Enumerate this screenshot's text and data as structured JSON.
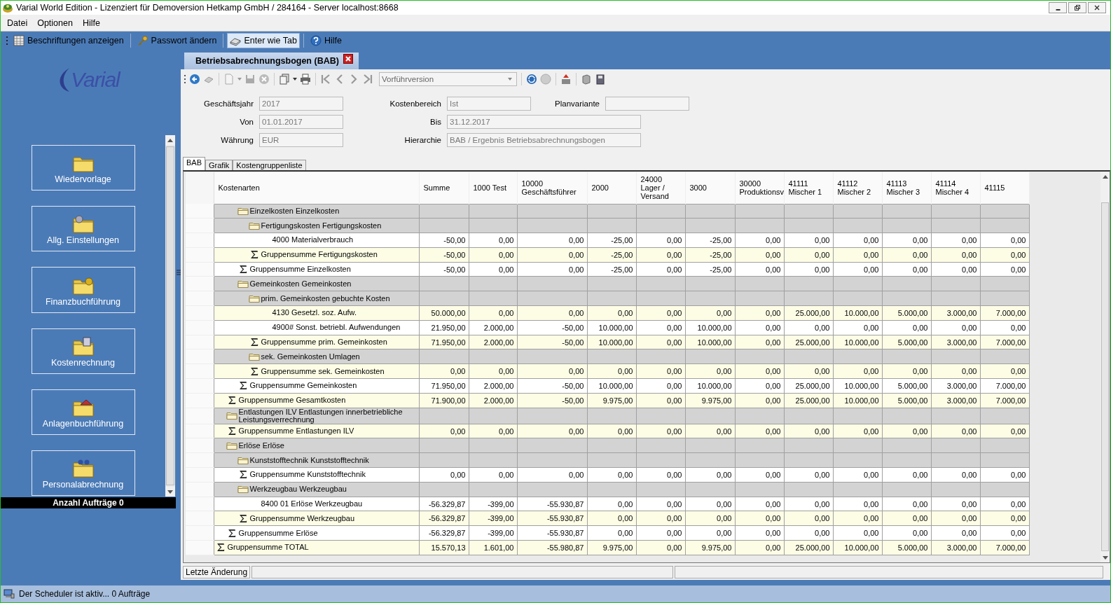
{
  "window": {
    "title": "Varial World Edition - Lizenziert für Demoversion Hetkamp GmbH / 284164 - Server localhost:8668"
  },
  "menu": [
    "Datei",
    "Optionen",
    "Hilfe"
  ],
  "toolbar": [
    {
      "label": "Beschriftungen anzeigen",
      "selected": false
    },
    {
      "label": "Passwort ändern",
      "selected": false
    },
    {
      "label": "Enter wie Tab",
      "selected": true
    },
    {
      "label": "Hilfe",
      "selected": false
    }
  ],
  "sidebar": {
    "logo": "Varial",
    "items": [
      {
        "label": "Wiedervorlage"
      },
      {
        "label": "Allg. Einstellungen"
      },
      {
        "label": "Finanzbuchführung"
      },
      {
        "label": "Kostenrechnung"
      },
      {
        "label": "Anlagenbuchführung"
      },
      {
        "label": "Personalabrechnung"
      }
    ],
    "orders": "Anzahl Aufträge 0"
  },
  "document": {
    "tab": "Betriebsabrechnungsbogen (BAB)",
    "version_select": "Vorführversion",
    "form": [
      [
        {
          "label": "Geschäftsjahr",
          "value": "2017"
        },
        {
          "label": "Kostenbereich",
          "value": "Ist"
        },
        {
          "label": "Planvariante"
        }
      ],
      [
        {
          "label": "Von",
          "value": "01.01.2017"
        },
        {
          "label": "Bis",
          "value": "31.12.2017"
        }
      ],
      [
        {
          "label": "Währung",
          "value": "EUR"
        },
        {
          "label": "Hierarchie",
          "value": "BAB / Ergebnis Betriebsabrechnungsbogen"
        }
      ]
    ],
    "tabs": [
      {
        "label": "BAB",
        "selected": true
      },
      {
        "label": "Grafik",
        "selected": false
      },
      {
        "label": "Kostengruppenliste",
        "selected": false
      }
    ],
    "table": {
      "columns": [
        "Kostenarten",
        "Summe",
        "1000 Test",
        "10000\nGeschäftsführer",
        "2000",
        "24000\nLager /\nVersand",
        "3000",
        "30000\nProduktionsv",
        "41111\nMischer 1",
        "41112\nMischer 2",
        "41113\nMischer 3",
        "41114\nMischer 4",
        "41115"
      ],
      "rows": [
        {
          "kind": "branch",
          "children": [
            {
              "kind": "branch",
              "children": [
                {
                  "kind": "group",
                  "label": "Einzelkosten Einzelkosten",
                  "children": [
                    {
                      "kind": "group",
                      "label": "Fertigungskosten Fertigungskosten",
                      "children": [
                        {
                          "kind": "item",
                          "label": "4000 Materialverbrauch",
                          "values": [
                            "-50,00",
                            "0,00",
                            "0,00",
                            "-25,00",
                            "0,00",
                            "-25,00",
                            "0,00",
                            "0,00",
                            "0,00",
                            "0,00",
                            "0,00",
                            "0,00"
                          ]
                        }
                      ]
                    },
                    {
                      "kind": "sum",
                      "label": "Gruppensumme Fertigungskosten",
                      "values": [
                        "-50,00",
                        "0,00",
                        "0,00",
                        "-25,00",
                        "0,00",
                        "-25,00",
                        "0,00",
                        "0,00",
                        "0,00",
                        "0,00",
                        "0,00",
                        "0,00"
                      ]
                    }
                  ]
                },
                {
                  "kind": "sum",
                  "label": "Gruppensumme Einzelkosten",
                  "values": [
                    "-50,00",
                    "0,00",
                    "0,00",
                    "-25,00",
                    "0,00",
                    "-25,00",
                    "0,00",
                    "0,00",
                    "0,00",
                    "0,00",
                    "0,00",
                    "0,00"
                  ]
                },
                {
                  "kind": "group",
                  "label": "Gemeinkosten Gemeinkosten",
                  "children": [
                    {
                      "kind": "group",
                      "label": "prim. Gemeinkosten gebuchte Kosten",
                      "children": [
                        {
                          "kind": "item",
                          "label": "4130 Gesetzl. soz. Aufw.",
                          "values": [
                            "50.000,00",
                            "0,00",
                            "0,00",
                            "0,00",
                            "0,00",
                            "0,00",
                            "0,00",
                            "25.000,00",
                            "10.000,00",
                            "5.000,00",
                            "3.000,00",
                            "7.000,00"
                          ]
                        },
                        {
                          "kind": "item",
                          "label": "4900# Sonst. betriebl. Aufwendungen",
                          "values": [
                            "21.950,00",
                            "2.000,00",
                            "-50,00",
                            "10.000,00",
                            "0,00",
                            "10.000,00",
                            "0,00",
                            "0,00",
                            "0,00",
                            "0,00",
                            "0,00",
                            "0,00"
                          ]
                        }
                      ]
                    },
                    {
                      "kind": "sum",
                      "label": "Gruppensumme prim. Gemeinkosten",
                      "values": [
                        "71.950,00",
                        "2.000,00",
                        "-50,00",
                        "10.000,00",
                        "0,00",
                        "10.000,00",
                        "0,00",
                        "25.000,00",
                        "10.000,00",
                        "5.000,00",
                        "3.000,00",
                        "7.000,00"
                      ]
                    },
                    {
                      "kind": "group",
                      "label": "sek. Gemeinkosten Umlagen"
                    },
                    {
                      "kind": "sum",
                      "label": "Gruppensumme sek. Gemeinkosten",
                      "values": [
                        "0,00",
                        "0,00",
                        "0,00",
                        "0,00",
                        "0,00",
                        "0,00",
                        "0,00",
                        "0,00",
                        "0,00",
                        "0,00",
                        "0,00",
                        "0,00"
                      ]
                    }
                  ]
                },
                {
                  "kind": "sum",
                  "label": "Gruppensumme Gemeinkosten",
                  "values": [
                    "71.950,00",
                    "2.000,00",
                    "-50,00",
                    "10.000,00",
                    "0,00",
                    "10.000,00",
                    "0,00",
                    "25.000,00",
                    "10.000,00",
                    "5.000,00",
                    "3.000,00",
                    "7.000,00"
                  ]
                }
              ]
            },
            {
              "kind": "sum",
              "label": "Gruppensumme Gesamtkosten",
              "values": [
                "71.900,00",
                "2.000,00",
                "-50,00",
                "9.975,00",
                "0,00",
                "9.975,00",
                "0,00",
                "25.000,00",
                "10.000,00",
                "5.000,00",
                "3.000,00",
                "7.000,00"
              ]
            },
            {
              "kind": "group",
              "label": "Entlastungen ILV Entlastungen innerbetriebliche Leistungsverrechnung"
            },
            {
              "kind": "sum",
              "label": "Gruppensumme Entlastungen ILV",
              "values": [
                "0,00",
                "0,00",
                "0,00",
                "0,00",
                "0,00",
                "0,00",
                "0,00",
                "0,00",
                "0,00",
                "0,00",
                "0,00",
                "0,00"
              ]
            },
            {
              "kind": "group",
              "label": "Erlöse Erlöse",
              "children": [
                {
                  "kind": "group",
                  "label": "Kunststofftechnik Kunststofftechnik"
                },
                {
                  "kind": "sum",
                  "label": "Gruppensumme Kunststofftechnik",
                  "values": [
                    "0,00",
                    "0,00",
                    "0,00",
                    "0,00",
                    "0,00",
                    "0,00",
                    "0,00",
                    "0,00",
                    "0,00",
                    "0,00",
                    "0,00",
                    "0,00"
                  ]
                },
                {
                  "kind": "group",
                  "label": "Werkzeugbau Werkzeugbau",
                  "children": [
                    {
                      "kind": "item",
                      "label": "8400 01 Erlöse Werkzeugbau",
                      "values": [
                        "-56.329,87",
                        "-399,00",
                        "-55.930,87",
                        "0,00",
                        "0,00",
                        "0,00",
                        "0,00",
                        "0,00",
                        "0,00",
                        "0,00",
                        "0,00",
                        "0,00"
                      ]
                    }
                  ]
                },
                {
                  "kind": "sum",
                  "label": "Gruppensumme Werkzeugbau",
                  "values": [
                    "-56.329,87",
                    "-399,00",
                    "-55.930,87",
                    "0,00",
                    "0,00",
                    "0,00",
                    "0,00",
                    "0,00",
                    "0,00",
                    "0,00",
                    "0,00",
                    "0,00"
                  ]
                }
              ]
            },
            {
              "kind": "sum",
              "label": "Gruppensumme Erlöse",
              "values": [
                "-56.329,87",
                "-399,00",
                "-55.930,87",
                "0,00",
                "0,00",
                "0,00",
                "0,00",
                "0,00",
                "0,00",
                "0,00",
                "0,00",
                "0,00"
              ]
            }
          ]
        },
        {
          "kind": "sum",
          "label": "Gruppensumme TOTAL",
          "values": [
            "15.570,13",
            "1.601,00",
            "-55.980,87",
            "9.975,00",
            "0,00",
            "9.975,00",
            "0,00",
            "25.000,00",
            "10.000,00",
            "5.000,00",
            "3.000,00",
            "7.000,00"
          ]
        }
      ]
    },
    "last_change_label": "Letzte Änderung"
  },
  "status_bar": "Der Scheduler ist aktiv... 0 Aufträge"
}
